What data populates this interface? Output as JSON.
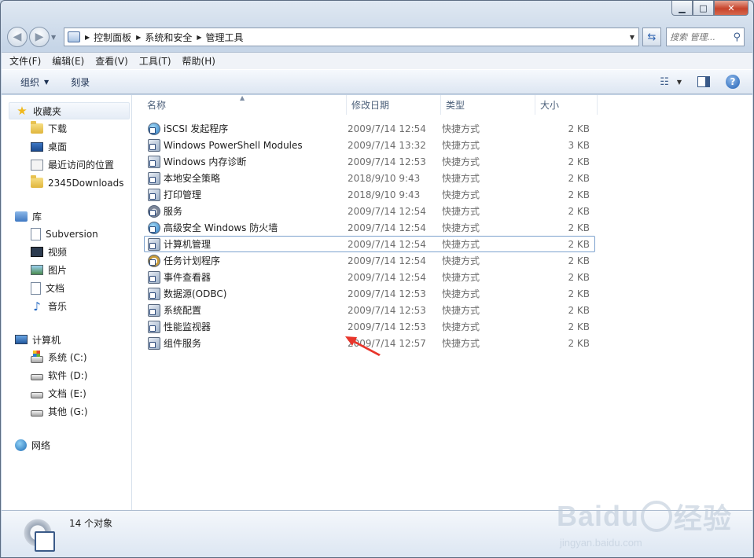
{
  "address": {
    "breadcrumbs": [
      "控制面板",
      "系统和安全",
      "管理工具"
    ],
    "search_placeholder": "搜索 管理..."
  },
  "menubar": [
    "文件(F)",
    "编辑(E)",
    "查看(V)",
    "工具(T)",
    "帮助(H)"
  ],
  "commandbar": {
    "organize": "组织",
    "burn": "刻录"
  },
  "nav": {
    "favorites": {
      "header": "收藏夹",
      "items": [
        "下载",
        "桌面",
        "最近访问的位置",
        "2345Downloads"
      ]
    },
    "libraries": {
      "header": "库",
      "items": [
        "Subversion",
        "视频",
        "图片",
        "文档",
        "音乐"
      ]
    },
    "computer": {
      "header": "计算机",
      "items": [
        "系统 (C:)",
        "软件 (D:)",
        "文档 (E:)",
        "其他 (G:)"
      ]
    },
    "network": {
      "header": "网络"
    }
  },
  "columns": {
    "name": "名称",
    "date": "修改日期",
    "type": "类型",
    "size": "大小"
  },
  "files": [
    {
      "name": "iSCSI 发起程序",
      "date": "2009/7/14 12:54",
      "type": "快捷方式",
      "size": "2 KB",
      "icon": "globe"
    },
    {
      "name": "Windows PowerShell Modules",
      "date": "2009/7/14 13:32",
      "type": "快捷方式",
      "size": "3 KB",
      "icon": "shortcut"
    },
    {
      "name": "Windows 内存诊断",
      "date": "2009/7/14 12:53",
      "type": "快捷方式",
      "size": "2 KB",
      "icon": "shortcut"
    },
    {
      "name": "本地安全策略",
      "date": "2018/9/10 9:43",
      "type": "快捷方式",
      "size": "2 KB",
      "icon": "shortcut"
    },
    {
      "name": "打印管理",
      "date": "2018/9/10 9:43",
      "type": "快捷方式",
      "size": "2 KB",
      "icon": "shortcut"
    },
    {
      "name": "服务",
      "date": "2009/7/14 12:54",
      "type": "快捷方式",
      "size": "2 KB",
      "icon": "gear"
    },
    {
      "name": "高级安全 Windows 防火墙",
      "date": "2009/7/14 12:54",
      "type": "快捷方式",
      "size": "2 KB",
      "icon": "globe"
    },
    {
      "name": "计算机管理",
      "date": "2009/7/14 12:54",
      "type": "快捷方式",
      "size": "2 KB",
      "icon": "shortcut"
    },
    {
      "name": "任务计划程序",
      "date": "2009/7/14 12:54",
      "type": "快捷方式",
      "size": "2 KB",
      "icon": "clock"
    },
    {
      "name": "事件查看器",
      "date": "2009/7/14 12:54",
      "type": "快捷方式",
      "size": "2 KB",
      "icon": "shortcut"
    },
    {
      "name": "数据源(ODBC)",
      "date": "2009/7/14 12:53",
      "type": "快捷方式",
      "size": "2 KB",
      "icon": "shortcut"
    },
    {
      "name": "系统配置",
      "date": "2009/7/14 12:53",
      "type": "快捷方式",
      "size": "2 KB",
      "icon": "shortcut"
    },
    {
      "name": "性能监视器",
      "date": "2009/7/14 12:53",
      "type": "快捷方式",
      "size": "2 KB",
      "icon": "shortcut"
    },
    {
      "name": "组件服务",
      "date": "2009/7/14 12:57",
      "type": "快捷方式",
      "size": "2 KB",
      "icon": "shortcut"
    }
  ],
  "status": {
    "count": "14 个对象"
  },
  "watermark": {
    "main": "Bai",
    "main2": "du",
    "cn": "经验",
    "sub": "jingyan.baidu.com"
  },
  "colors": {
    "annotation_arrow": "#e8352b",
    "focus_border": "#7da2ce"
  }
}
